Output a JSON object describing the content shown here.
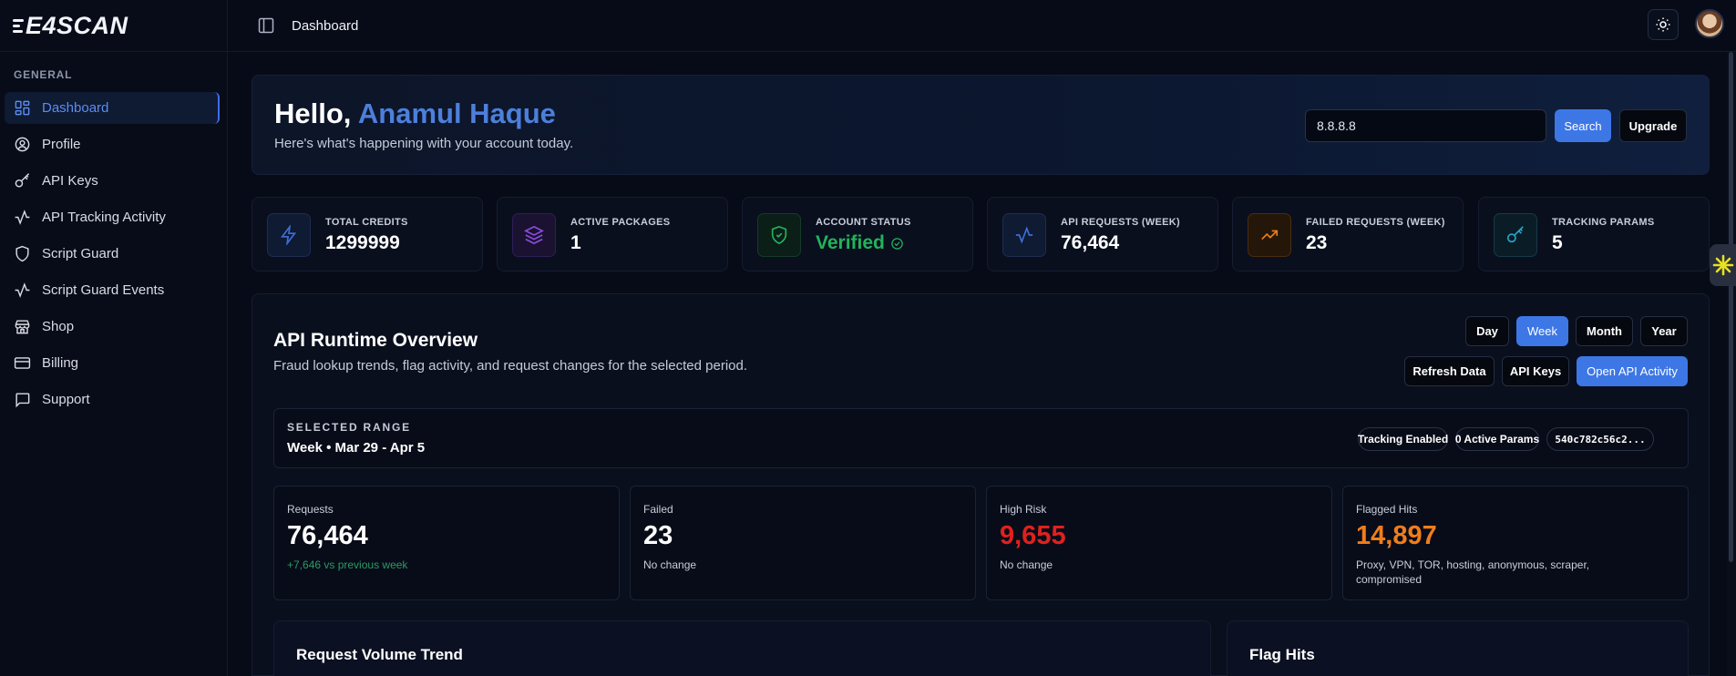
{
  "brand": {
    "name": "E4SCAN"
  },
  "sidebar": {
    "section": "GENERAL",
    "items": [
      {
        "label": "Dashboard",
        "icon": "dashboard-icon",
        "active": true
      },
      {
        "label": "Profile",
        "icon": "user-circle-icon"
      },
      {
        "label": "API Keys",
        "icon": "key-icon"
      },
      {
        "label": "API Tracking Activity",
        "icon": "activity-icon"
      },
      {
        "label": "Script Guard",
        "icon": "shield-icon"
      },
      {
        "label": "Script Guard Events",
        "icon": "activity-icon"
      },
      {
        "label": "Shop",
        "icon": "store-icon"
      },
      {
        "label": "Billing",
        "icon": "credit-card-icon"
      },
      {
        "label": "Support",
        "icon": "message-icon"
      }
    ]
  },
  "header": {
    "title": "Dashboard"
  },
  "hero": {
    "greeting": "Hello,",
    "name": "Anamul Haque",
    "subtitle": "Here's what's happening with your account today.",
    "search_value": "8.8.8.8",
    "search_label": "Search",
    "upgrade_label": "Upgrade"
  },
  "stats": [
    {
      "label": "TOTAL CREDITS",
      "value": "1299999",
      "icon": "lightning-icon",
      "color": "#3d6fd6"
    },
    {
      "label": "ACTIVE PACKAGES",
      "value": "1",
      "icon": "layers-icon",
      "color": "#8b4be0"
    },
    {
      "label": "ACCOUNT STATUS",
      "value": "Verified",
      "icon": "shield-check-icon",
      "color": "#22b35a"
    },
    {
      "label": "API REQUESTS (WEEK)",
      "value": "76,464",
      "icon": "activity-icon",
      "color": "#3d6fd6"
    },
    {
      "label": "FAILED REQUESTS (WEEK)",
      "value": "23",
      "icon": "trending-up-icon",
      "color": "#f07d1b"
    },
    {
      "label": "TRACKING PARAMS",
      "value": "5",
      "icon": "key-icon",
      "color": "#2aa3c9"
    }
  ],
  "overview": {
    "title": "API Runtime Overview",
    "subtitle": "Fraud lookup trends, flag activity, and request changes for the selected period.",
    "periods": [
      "Day",
      "Week",
      "Month",
      "Year"
    ],
    "active_period": "Week",
    "actions": {
      "refresh": "Refresh Data",
      "keys": "API Keys",
      "open": "Open API Activity"
    },
    "range": {
      "label": "SELECTED RANGE",
      "value": "Week • Mar 29 - Apr 5",
      "pills": [
        "Tracking Enabled",
        "0 Active Params",
        "540c782c56c2..."
      ]
    },
    "metrics": [
      {
        "label": "Requests",
        "value": "76,464",
        "note": "+7,646 vs previous week"
      },
      {
        "label": "Failed",
        "value": "23",
        "note": "No change"
      },
      {
        "label": "High Risk",
        "value": "9,655",
        "note": "No change"
      },
      {
        "label": "Flagged Hits",
        "value": "14,897",
        "note": "Proxy, VPN, TOR, hosting, anonymous, scraper, compromised"
      }
    ],
    "charts": {
      "volume": "Request Volume Trend",
      "flags": "Flag Hits"
    }
  }
}
